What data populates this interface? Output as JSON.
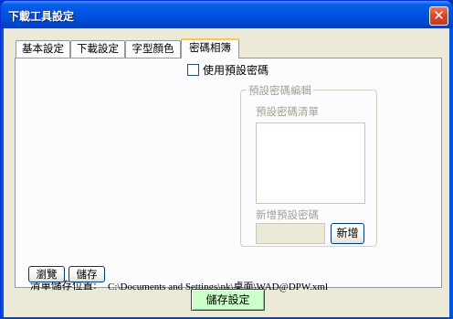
{
  "window": {
    "title": "下載工具設定",
    "close_glyph": "✕"
  },
  "tabs": [
    {
      "label": "基本設定",
      "active": false
    },
    {
      "label": "下載設定",
      "active": false
    },
    {
      "label": "字型顏色",
      "active": false
    },
    {
      "label": "密碼相簿",
      "active": true
    }
  ],
  "password_tab": {
    "use_default_checkbox": {
      "label": "使用預設密碼",
      "checked": false
    },
    "group": {
      "title": "預設密碼編輯",
      "list_label": "預設密碼清單",
      "list_items": [],
      "new_label": "新增預設密碼",
      "new_value": "",
      "add_button": "新增"
    },
    "save_location_label": "清單儲存位置:",
    "save_location_path": "C:\\Documents and Settings\\pk\\桌面\\WAD@DPW.xml",
    "browse_button": "瀏覽",
    "save_button": "儲存"
  },
  "footer": {
    "save_settings_button": "儲存設定"
  },
  "colors": {
    "titlebar": "#0054e3",
    "client_bg": "#ece9d8",
    "tab_highlight": "#ffc73c",
    "save_settings_bg": "#ccffcc",
    "disabled_text": "#a1a192"
  }
}
